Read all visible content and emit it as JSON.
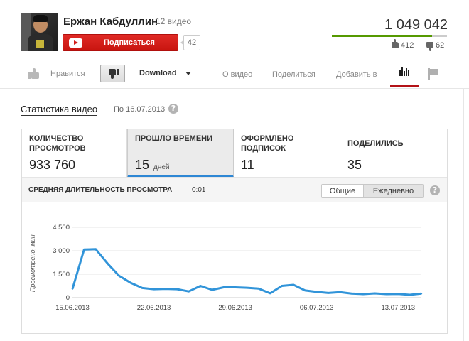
{
  "channel": {
    "name": "Ержан Кабдуллин",
    "separator": "·",
    "videos": "12 видео",
    "subscribe_label": "Подписаться",
    "subscriber_count": "42"
  },
  "video_stats": {
    "views_total": "1 049 042",
    "likes": "412",
    "dislikes": "62",
    "like_ratio": 0.87
  },
  "actions": {
    "like_label": "Нравится",
    "download_label": "Download",
    "tabs": [
      "О видео",
      "Поделиться",
      "Добавить в"
    ]
  },
  "stats": {
    "title": "Статистика видео",
    "since": "По 16.07.2013",
    "help": "?",
    "metrics": [
      {
        "label": "КОЛИЧЕСТВО ПРОСМОТРОВ",
        "value": "933 760",
        "unit": ""
      },
      {
        "label": "ПРОШЛО ВРЕМЕНИ",
        "value": "15",
        "unit": "дней"
      },
      {
        "label": "ОФОРМЛЕНО ПОДПИСОК",
        "value": "11",
        "unit": ""
      },
      {
        "label": "ПОДЕЛИЛИСЬ",
        "value": "35",
        "unit": ""
      }
    ],
    "avg_duration_label": "СРЕДНЯЯ ДЛИТЕЛЬНОСТЬ ПРОСМОТРА",
    "avg_duration_value": "0:01",
    "toggle_total": "Общие",
    "toggle_daily": "Ежедневно"
  },
  "chart_data": {
    "type": "line",
    "ylabel": "Просмотрено, мин.",
    "ylim": [
      0,
      4500
    ],
    "yticks": [
      "4 500",
      "3 000",
      "1 500",
      "0"
    ],
    "xticks": [
      "15.06.2013",
      "22.06.2013",
      "29.06.2013",
      "06.07.2013",
      "13.07.2013"
    ],
    "xrange_days": 31,
    "grid": true,
    "line_color": "#3194d9",
    "values": [
      560,
      3080,
      3100,
      2200,
      1400,
      950,
      620,
      540,
      560,
      540,
      400,
      750,
      500,
      660,
      660,
      630,
      580,
      280,
      750,
      820,
      460,
      370,
      300,
      350,
      260,
      230,
      270,
      230,
      240,
      180,
      260
    ]
  }
}
